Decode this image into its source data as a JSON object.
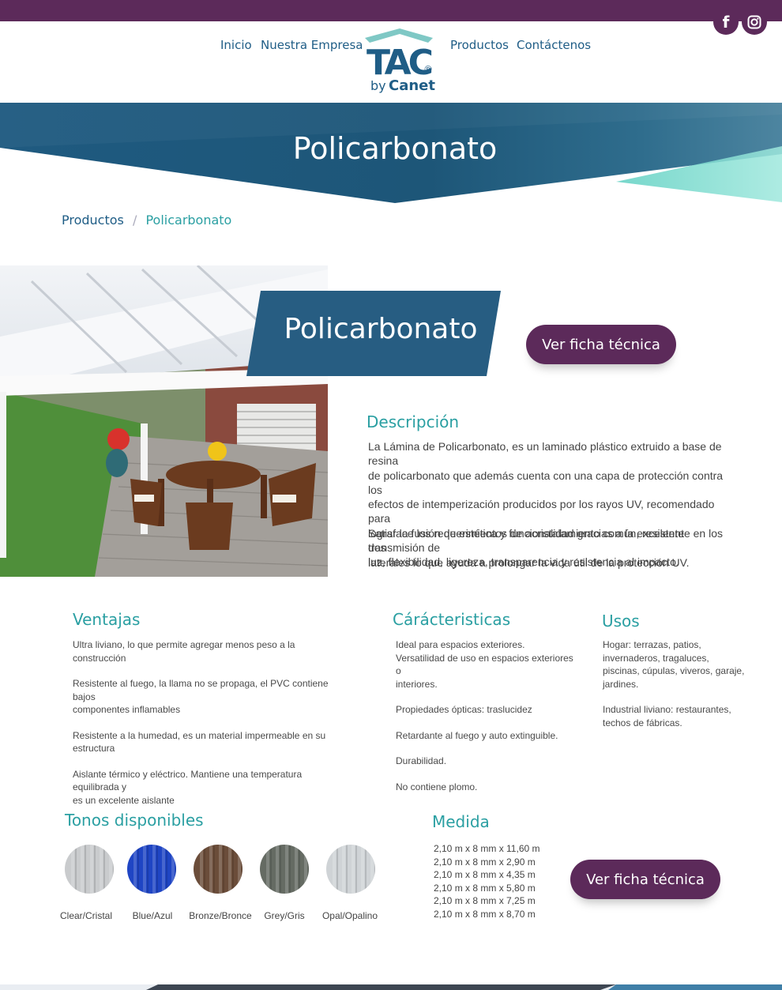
{
  "colors": {
    "brand_purple": "#5c2a5a",
    "brand_blue": "#1f5d86",
    "accent_teal": "#2a9fa2"
  },
  "social": {
    "facebook_icon": "facebook-icon",
    "instagram_icon": "instagram-icon"
  },
  "nav": {
    "inicio": "Inicio",
    "empresa": "Nuestra Empresa",
    "productos": "Productos",
    "contacto": "Contáctenos"
  },
  "logo": {
    "mark": "TAC",
    "registered": "®",
    "by": "by",
    "brand": "Canet"
  },
  "hero": {
    "title": "Policarbonato"
  },
  "breadcrumb": {
    "parent": "Productos",
    "separator": "/",
    "current": "Policarbonato"
  },
  "product": {
    "title": "Policarbonato",
    "cta_top": "Ver ficha técnica",
    "cta_bottom": "Ver ficha técnica"
  },
  "descripcion": {
    "heading": "Descripción",
    "lines1": [
      "La Lámina de Policarbonato, es un laminado plástico extruido a base de resina",
      "de policarbonato que además cuenta con una capa de protección contra los",
      "efectos de intemperización producidos por los rayos UV, recomendado para",
      "lograr la fusión de estética y funcionalidad gracias a la excelente transmisión de",
      "luz, flexibilidad, ligereza, transparencia y resistencia al impacto."
    ],
    "lines2": [
      "Satisface los requerimientos de acristalamiento común, resistente en los dos",
      "laterales lo que ayuda a prolongar la vida útil de la protección UV."
    ]
  },
  "ventajas": {
    "heading": "Ventajas",
    "items": [
      [
        "Ultra liviano, lo que permite agregar menos peso a la construcción"
      ],
      [
        "Resistente al fuego, la llama no se propaga, el PVC contiene bajos",
        "componentes inflamables"
      ],
      [
        "Resistente a la humedad, es un material impermeable en su",
        "estructura"
      ],
      [
        "Aislante térmico y eléctrico. Mantiene una temperatura equilibrada y",
        "es un excelente aislante"
      ]
    ]
  },
  "caracteristicas": {
    "heading": "Cárácteristicas",
    "items": [
      [
        "Ideal para espacios exteriores.",
        "Versatilidad de uso en espacios exteriores o",
        "interiores."
      ],
      [
        "Propiedades ópticas: traslucidez"
      ],
      [
        "Retardante al fuego y auto extinguible."
      ],
      [
        "Durabilidad."
      ],
      [
        "No contiene plomo."
      ]
    ]
  },
  "usos": {
    "heading": "Usos",
    "items": [
      [
        "Hogar: terrazas, patios,",
        "invernaderos, tragaluces,",
        "piscinas, cúpulas, viveros, garaje,",
        "jardines."
      ],
      [
        "Industrial liviano: restaurantes,",
        "techos de fábricas."
      ]
    ]
  },
  "tonos": {
    "heading": "Tonos disponibles",
    "items": [
      {
        "label": "Clear/Cristal",
        "color": "#c9cbcd"
      },
      {
        "label": "Blue/Azul",
        "color": "#1f45c4"
      },
      {
        "label": "Bronze/Bronce",
        "color": "#6b4d3a"
      },
      {
        "label": "Grey/Gris",
        "color": "#656b63"
      },
      {
        "label": "Opal/Opalino",
        "color": "#cfd3d6"
      }
    ]
  },
  "medida": {
    "heading": "Medida",
    "items": [
      "2,10 m x 8 mm x 11,60 m",
      "2,10 m x 8 mm x 2,90 m",
      "2,10 m x 8 mm x 4,35 m",
      "2,10 m x 8 mm x 5,80 m",
      "2,10 m x 8 mm x 7,25 m",
      "2,10 m x 8 mm x 8,70 m"
    ]
  }
}
